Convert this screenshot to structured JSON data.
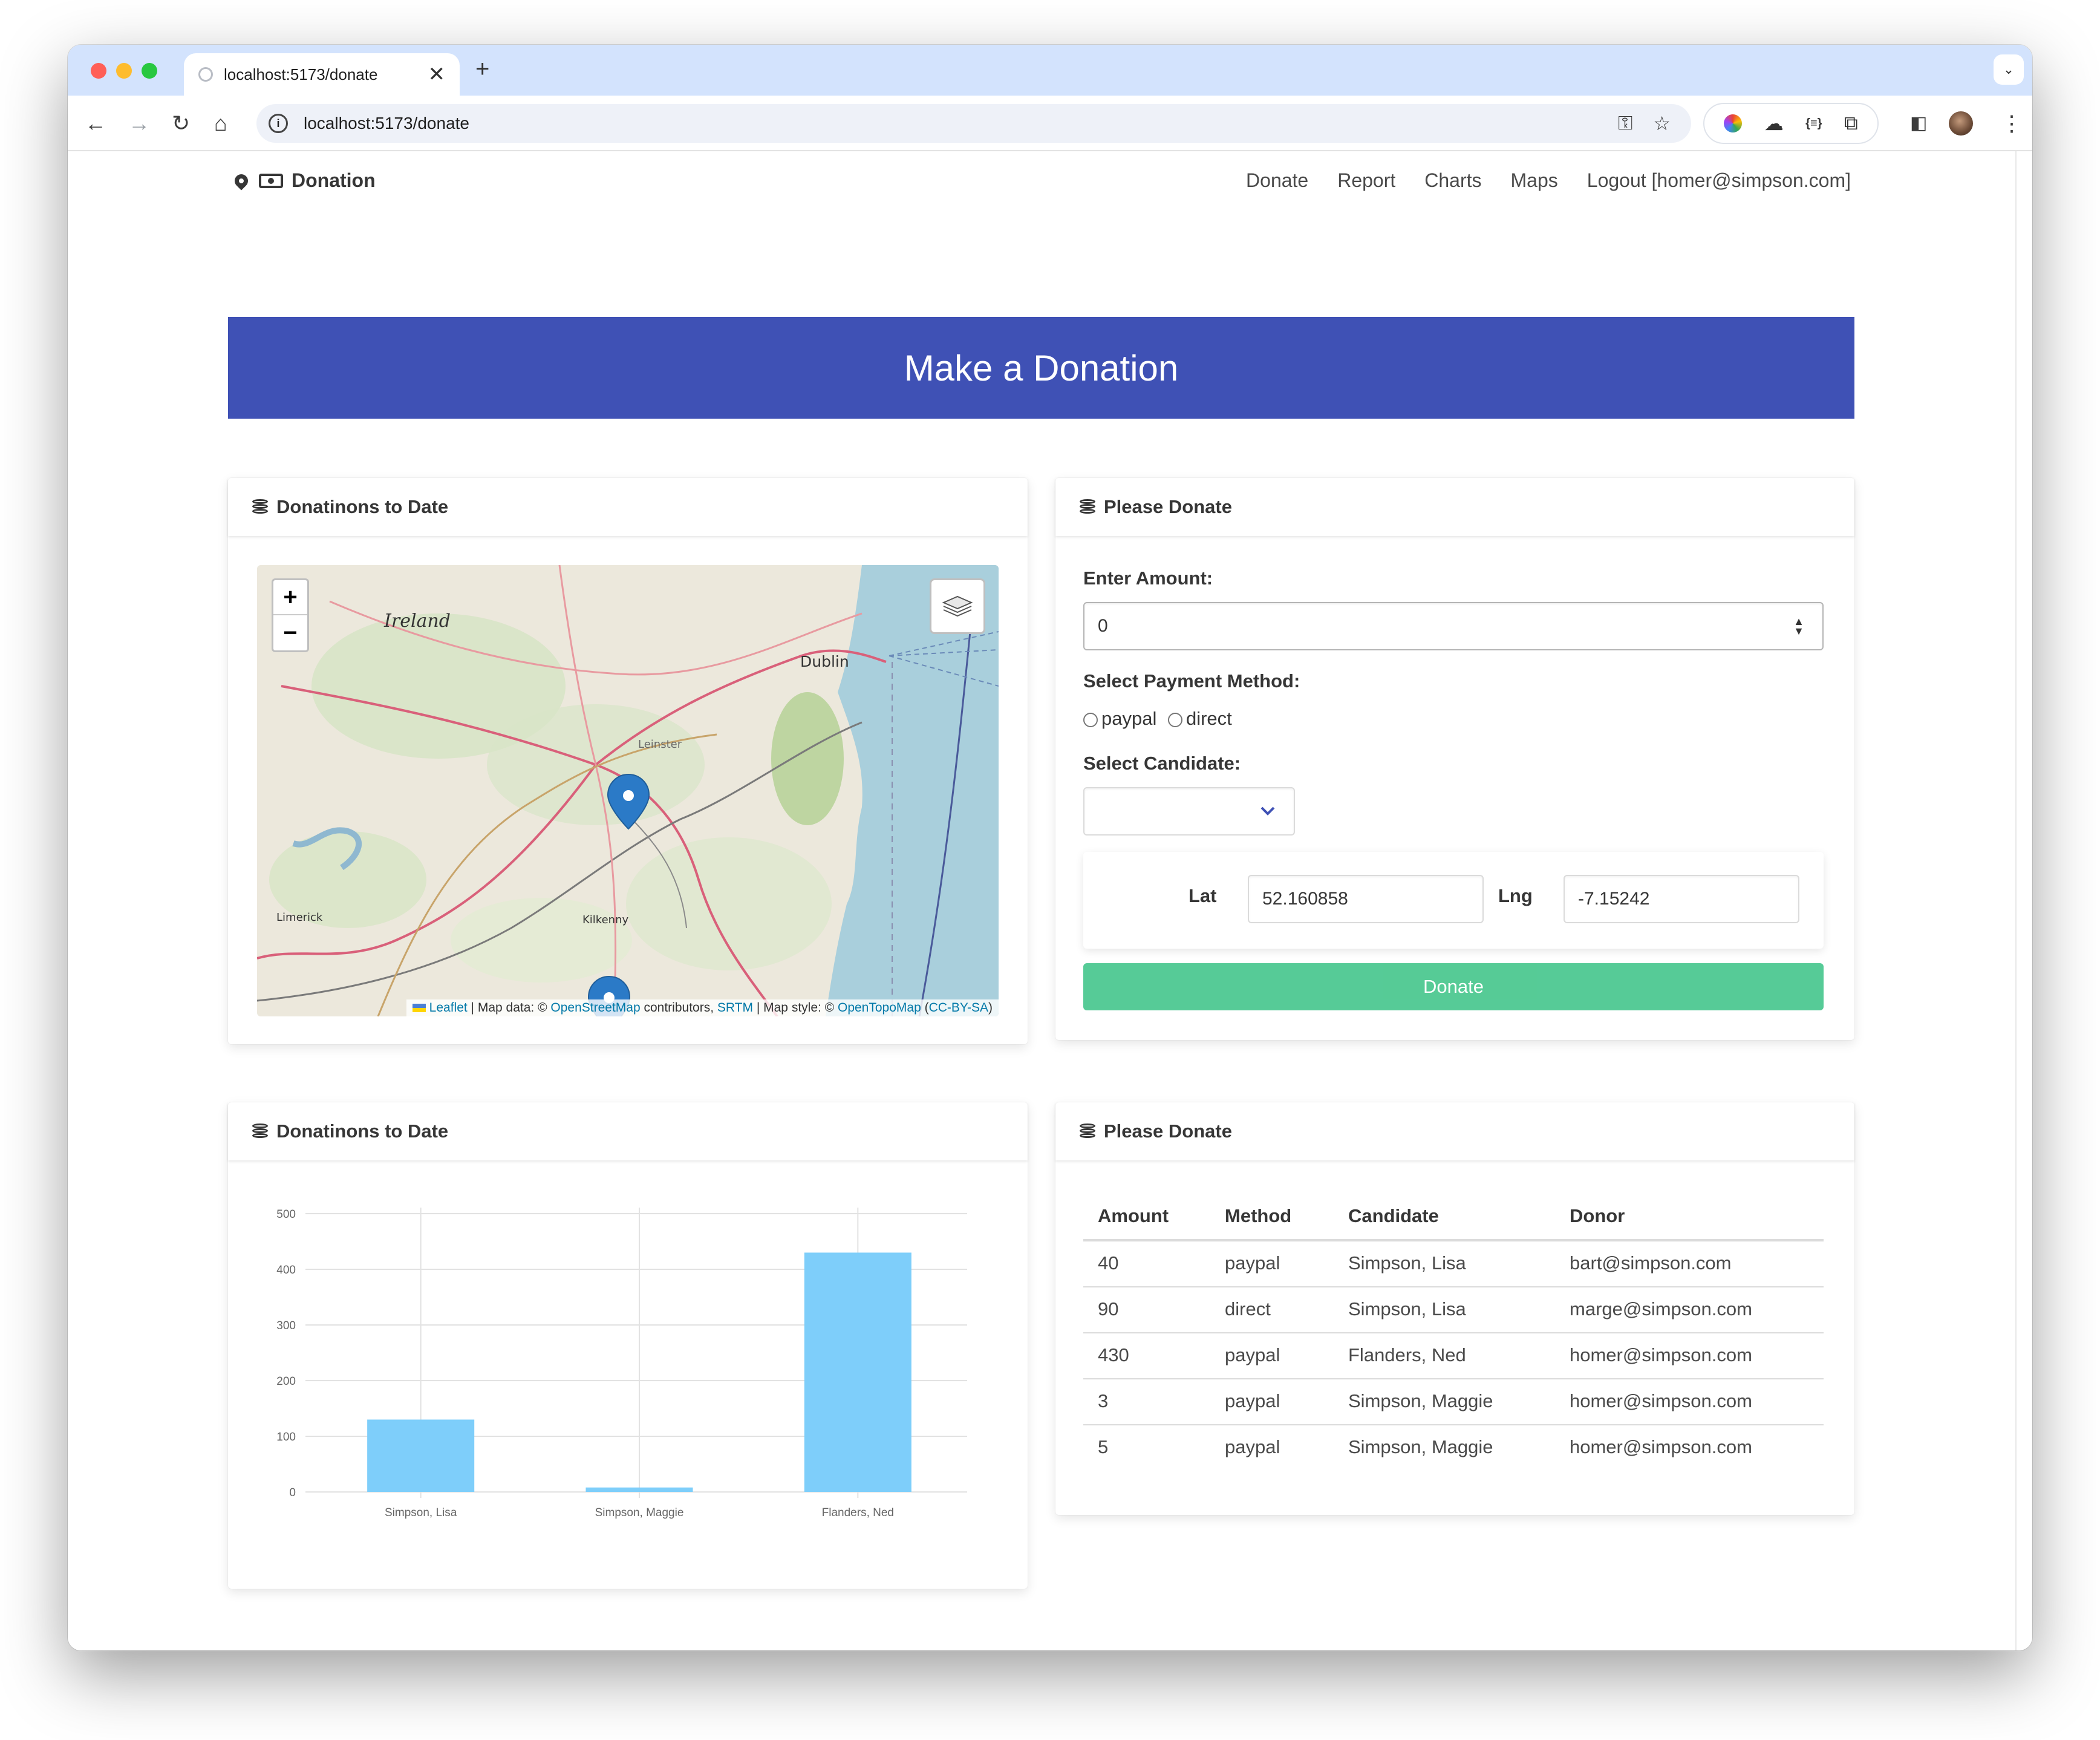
{
  "browser": {
    "tab_title": "localhost:5173/donate",
    "tab_close": "✕",
    "new_tab": "+",
    "url": "localhost:5173/donate"
  },
  "navbar": {
    "brand": "Donation",
    "links": [
      "Donate",
      "Report",
      "Charts",
      "Maps",
      "Logout [homer@simpson.com]"
    ]
  },
  "hero": {
    "title": "Make a Donation"
  },
  "map_card": {
    "title": "Donatinons to Date",
    "zoom_in": "+",
    "zoom_out": "−",
    "places": [
      "Ireland",
      "Dublin",
      "Leinster",
      "Limerick",
      "Kilkenny"
    ],
    "attribution": {
      "leaflet": "Leaflet",
      "sep1": " | Map data: © ",
      "osm": "OpenStreetMap",
      "contrib": " contributors, ",
      "srtm": "SRTM",
      "style": " | Map style: © ",
      "otm": "OpenTopoMap",
      "open": " (",
      "cc": "CC-BY-SA",
      "close": ")"
    }
  },
  "form_card": {
    "title": "Please Donate",
    "amount_label": "Enter Amount:",
    "amount_value": "0",
    "payment_label": "Select Payment Method:",
    "payment_options": [
      "paypal",
      "direct"
    ],
    "candidate_label": "Select Candidate:",
    "candidate_value": "",
    "lat_label": "Lat",
    "lat_value": "52.160858",
    "lng_label": "Lng",
    "lng_value": "-7.15242",
    "submit_label": "Donate"
  },
  "chart_card": {
    "title": "Donatinons to Date"
  },
  "chart_data": {
    "type": "bar",
    "categories": [
      "Simpson, Lisa",
      "Simpson, Maggie",
      "Flanders, Ned"
    ],
    "values": [
      130,
      8,
      430
    ],
    "yticks": [
      0,
      100,
      200,
      300,
      400,
      500
    ],
    "ylim": [
      0,
      500
    ],
    "title": "",
    "xlabel": "",
    "ylabel": "",
    "grid": true,
    "color": "#7ecefa"
  },
  "table_card": {
    "title": "Please Donate",
    "headers": [
      "Amount",
      "Method",
      "Candidate",
      "Donor"
    ],
    "rows": [
      [
        "40",
        "paypal",
        "Simpson, Lisa",
        "bart@simpson.com"
      ],
      [
        "90",
        "direct",
        "Simpson, Lisa",
        "marge@simpson.com"
      ],
      [
        "430",
        "paypal",
        "Flanders, Ned",
        "homer@simpson.com"
      ],
      [
        "3",
        "paypal",
        "Simpson, Maggie",
        "homer@simpson.com"
      ],
      [
        "5",
        "paypal",
        "Simpson, Maggie",
        "homer@simpson.com"
      ]
    ]
  },
  "colors": {
    "hero": "#3f51b5",
    "button": "#48c78e",
    "bar": "#7ecefa",
    "link": "#0078a8"
  }
}
